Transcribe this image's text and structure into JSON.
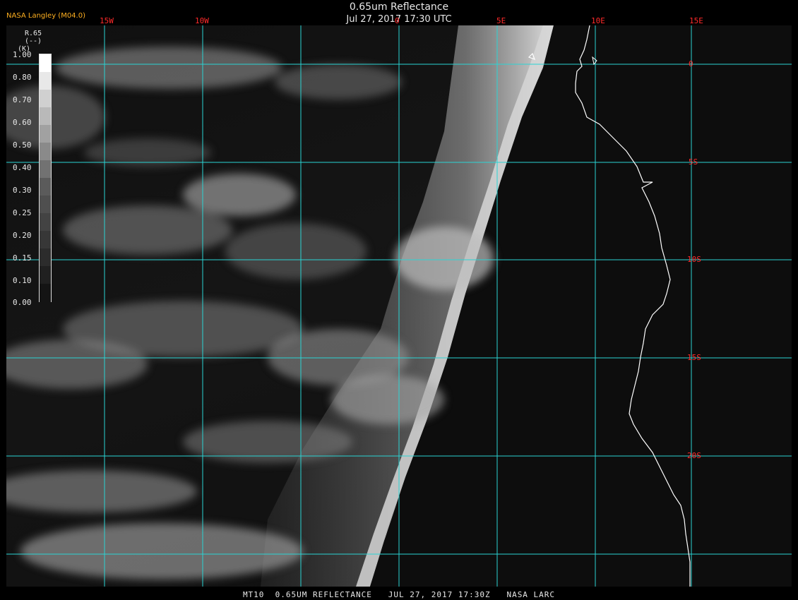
{
  "header": {
    "title": "0.65um Reflectance",
    "date": "Jul 27, 2017 17:30 UTC",
    "brand": "NASA Langley (M04.0)"
  },
  "legend": {
    "title_line1": "R.65",
    "title_line2": "(--)",
    "title_line3": "(K)",
    "ticks": [
      "1.00",
      "0.80",
      "0.70",
      "0.60",
      "0.50",
      "0.40",
      "0.30",
      "0.25",
      "0.20",
      "0.15",
      "0.10",
      "0.00"
    ],
    "levels": [
      1.0,
      0.9,
      0.8,
      0.7,
      0.6,
      0.5,
      0.4,
      0.3,
      0.25,
      0.2,
      0.15,
      0.1,
      0.05,
      0.0
    ]
  },
  "grid": {
    "longitudes": [
      "15W",
      "10W",
      "0",
      "5E",
      "10E",
      "15E"
    ],
    "latitudes": [
      "0",
      "5S",
      "10S",
      "15S",
      "20S"
    ],
    "line_color": "#2ad4d4",
    "label_color": "#ff2a2a"
  },
  "coastline": {
    "color": "#ffffff",
    "description_icon": "coastline-icon"
  },
  "footer": {
    "text": "MT10  0.65UM REFLECTANCE   JUL 27, 2017 17:30Z   NASA LARC"
  }
}
